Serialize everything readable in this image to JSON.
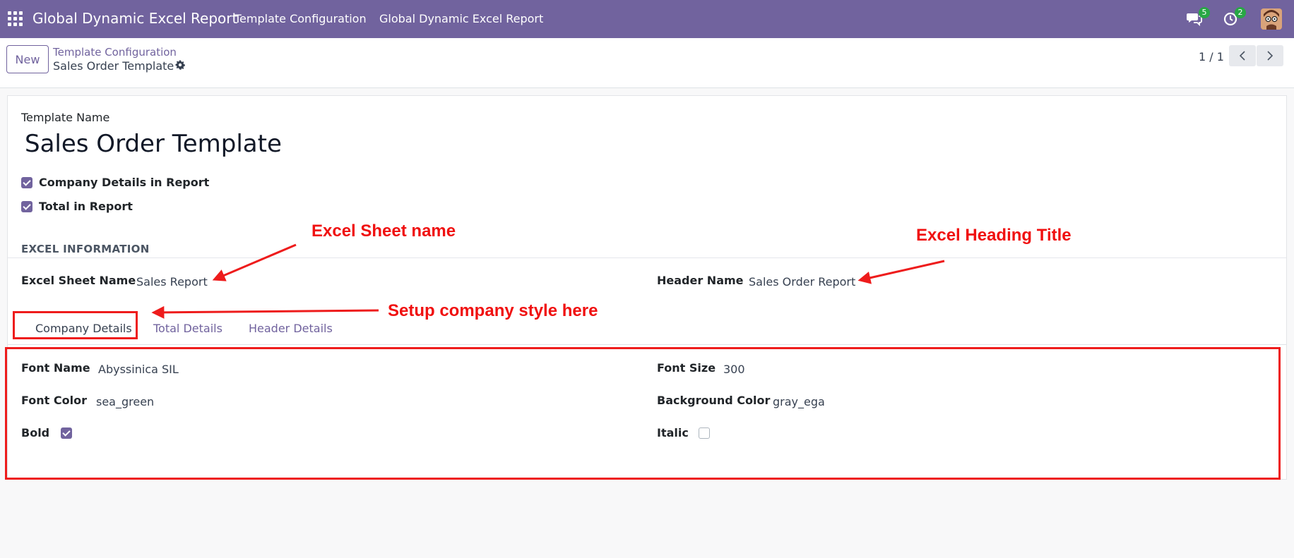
{
  "navbar": {
    "brand": "Global Dynamic Excel Report",
    "menu": [
      "Template Configuration",
      "Global Dynamic Excel Report"
    ],
    "messages_count": "5",
    "activities_count": "2"
  },
  "control_panel": {
    "new_label": "New",
    "breadcrumb_parent": "Template Configuration",
    "breadcrumb_current": "Sales Order Template",
    "pager": "1 / 1"
  },
  "form": {
    "template_name_label": "Template Name",
    "template_name_value": "Sales Order Template",
    "company_details_label": "Company Details in Report",
    "company_details_checked": true,
    "total_label": "Total in Report",
    "total_checked": true,
    "section_title": "EXCEL INFORMATION",
    "sheet_name_label": "Excel Sheet Name",
    "sheet_name_value": "Sales Report",
    "header_name_label": "Header Name",
    "header_name_value": "Sales Order Report",
    "tabs": [
      "Company Details",
      "Total Details",
      "Header Details"
    ],
    "active_tab": "Company Details",
    "company_tab": {
      "font_name_label": "Font Name",
      "font_name_value": "Abyssinica SIL",
      "font_size_label": "Font Size",
      "font_size_value": "300",
      "font_color_label": "Font Color",
      "font_color_value": "sea_green",
      "bg_color_label": "Background Color",
      "bg_color_value": "gray_ega",
      "bold_label": "Bold",
      "bold_checked": true,
      "italic_label": "Italic",
      "italic_checked": false
    }
  },
  "annotations": {
    "sheet_name_note": "Excel Sheet name",
    "heading_note": "Excel Heading Title",
    "company_style_note": "Setup company style here"
  },
  "colors": {
    "brand": "#71639e",
    "annotation": "#ee1c1c",
    "badge": "#28a745"
  }
}
